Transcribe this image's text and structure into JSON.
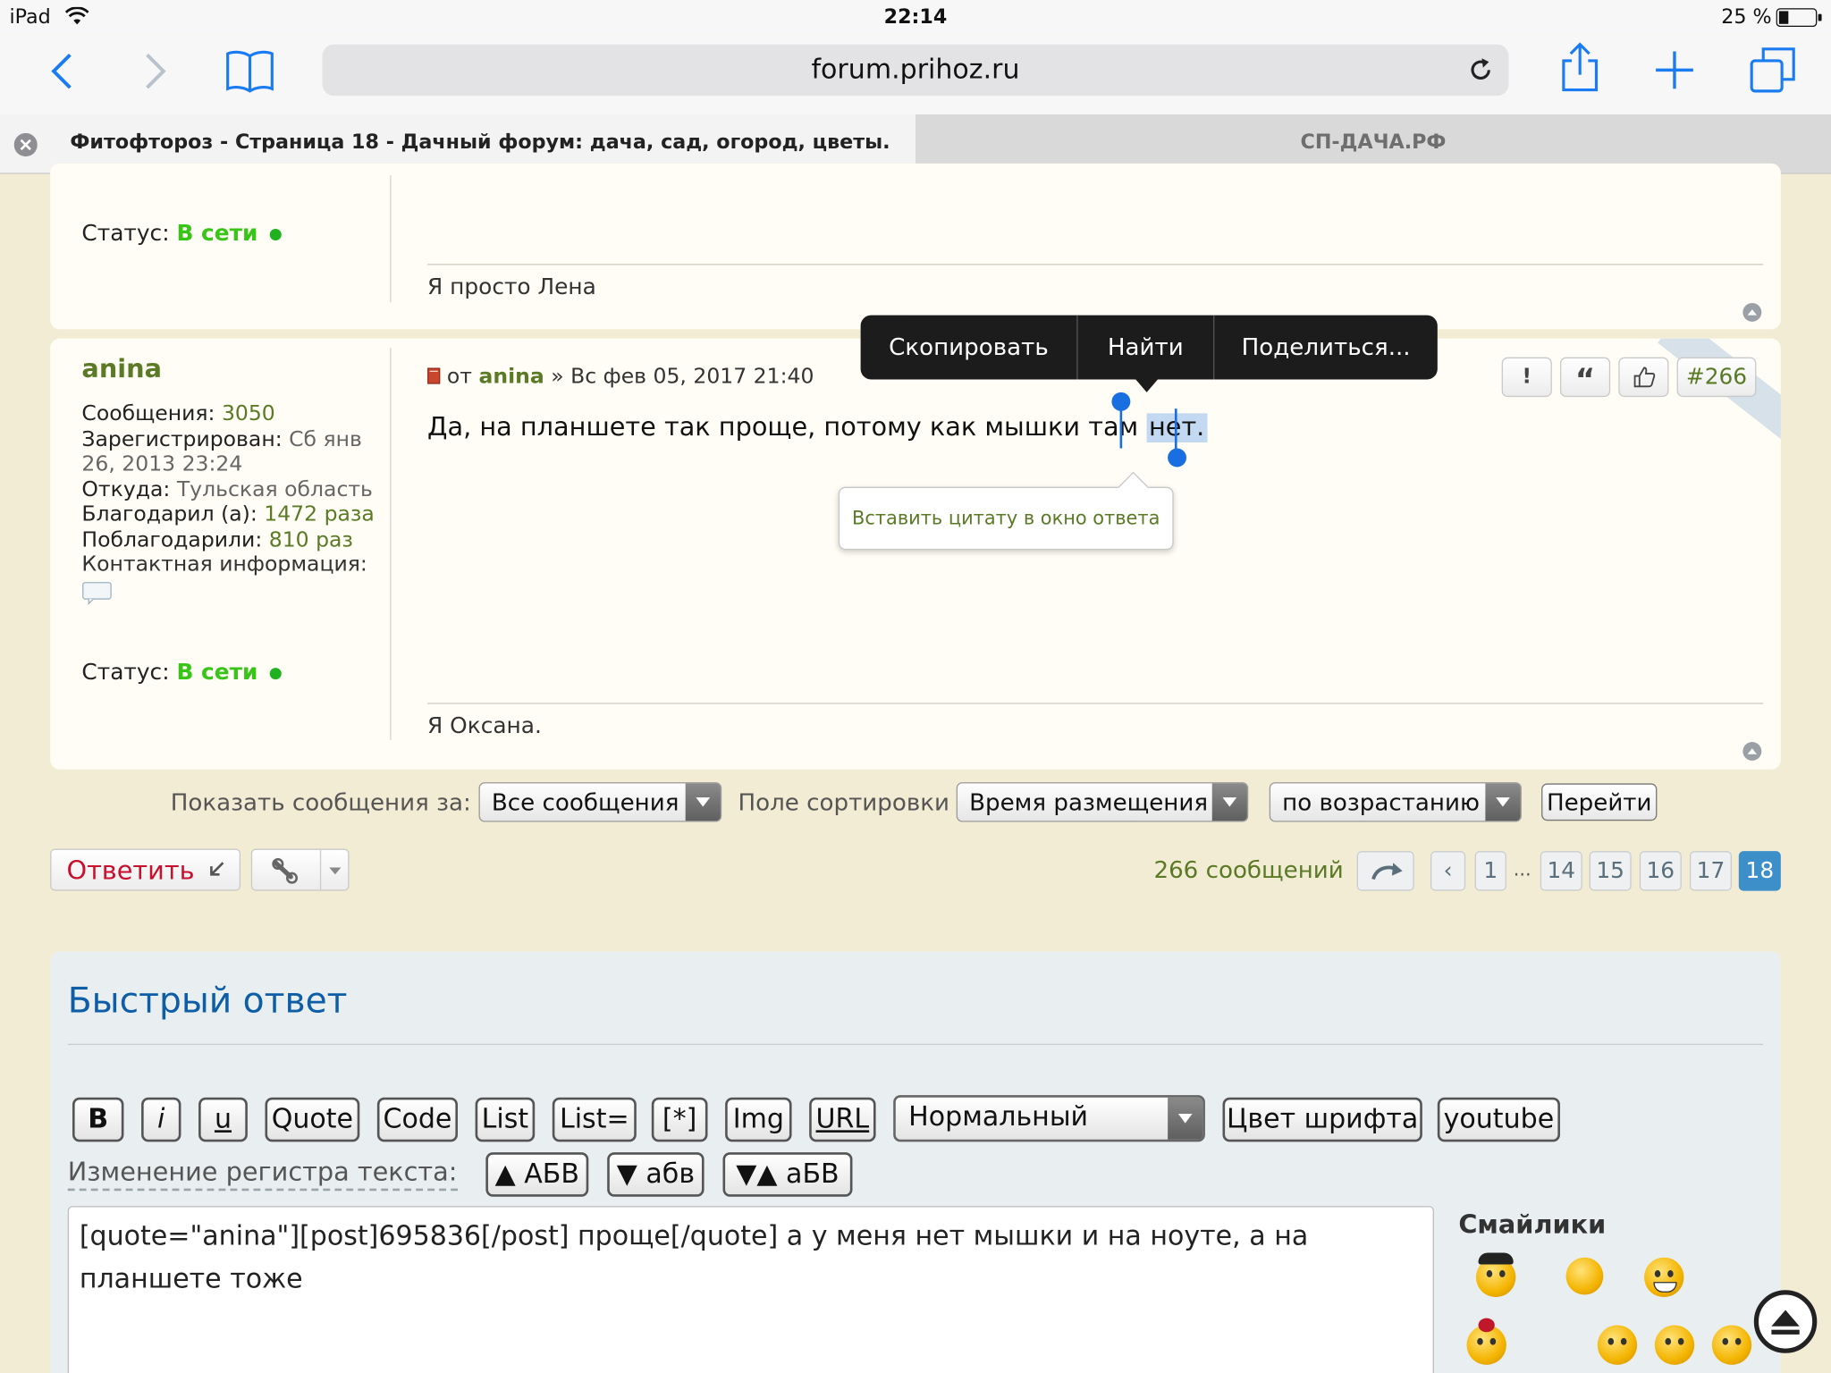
{
  "status_bar": {
    "device": "iPad",
    "time": "22:14",
    "battery": "25 %"
  },
  "browser": {
    "url": "forum.prihoz.ru",
    "tabs": [
      {
        "title": "Фитофтороз - Страница 18 - Дачный форум: дача, сад, огород, цветы."
      },
      {
        "title": "СП-ДАЧА.РФ"
      }
    ]
  },
  "prev_post": {
    "status_label": "Статус:",
    "status_value": "В сети",
    "signature": "Я просто Лена"
  },
  "post": {
    "author": "anina",
    "profile": [
      {
        "label": "Сообщения:",
        "value": "3050"
      },
      {
        "label": "Зарегистрирован:",
        "value": "Сб янв"
      },
      {
        "label": "",
        "value": "26, 2013 23:24"
      },
      {
        "label": "Откуда:",
        "value": "Тульская область"
      },
      {
        "label": "Благодарил (а):",
        "value": "1472 раза"
      },
      {
        "label": "Поблагодарили:",
        "value": "810 раз"
      }
    ],
    "contact_label": "Контактная информация:",
    "status_label": "Статус:",
    "status_value": "В сети",
    "meta_from": "от",
    "meta_author": "anina",
    "meta_date": "» Вс фев 05, 2017 21:40",
    "text_before": "Да, на планшете так проще, потому как мышки там ",
    "text_selected": "нет.",
    "signature": "Я Оксана.",
    "post_number": "#266",
    "buttons": {
      "report": "!",
      "quote": "“"
    }
  },
  "context_menu": {
    "items": [
      "Скопировать",
      "Найти",
      "Поделиться..."
    ]
  },
  "quote_tooltip": "Вставить цитату в окно ответа",
  "filters": {
    "show_label": "Показать сообщения за:",
    "show_value": "Все сообщения",
    "sort_label": "Поле сортировки",
    "sort_value": "Время размещения",
    "order_value": "по возрастанию",
    "go_button": "Перейти"
  },
  "actions": {
    "reply_button": "Ответить"
  },
  "pagination": {
    "count": "266 сообщений",
    "prev": "‹",
    "pages": [
      "1",
      "...",
      "14",
      "15",
      "16",
      "17",
      "18"
    ],
    "current": "18"
  },
  "quick_reply": {
    "title": "Быстрый ответ",
    "bbcode_buttons": [
      "B",
      "i",
      "u",
      "Quote",
      "Code",
      "List",
      "List=",
      "[*]",
      "Img",
      "URL"
    ],
    "font_size_value": "Нормальный",
    "font_color_button": "Цвет шрифта",
    "youtube_button": "youtube",
    "case_label": "Изменение регистра текста:",
    "case_buttons": [
      "▲ АБВ",
      "▼ абв",
      "▼▲ аБВ"
    ],
    "text_line1": "[quote=\"anina\"][post]695836[/post] проще[/quote] а у меня нет мышки и на ноуте, а на",
    "text_line2": "планшете тоже",
    "smilies_title": "Смайлики"
  },
  "colors": {
    "accent_green": "#5a7a26",
    "online_green": "#39c418",
    "reply_red": "#c8102e",
    "link_blue": "#0d5ea6",
    "current_page": "#3d8fc9"
  }
}
